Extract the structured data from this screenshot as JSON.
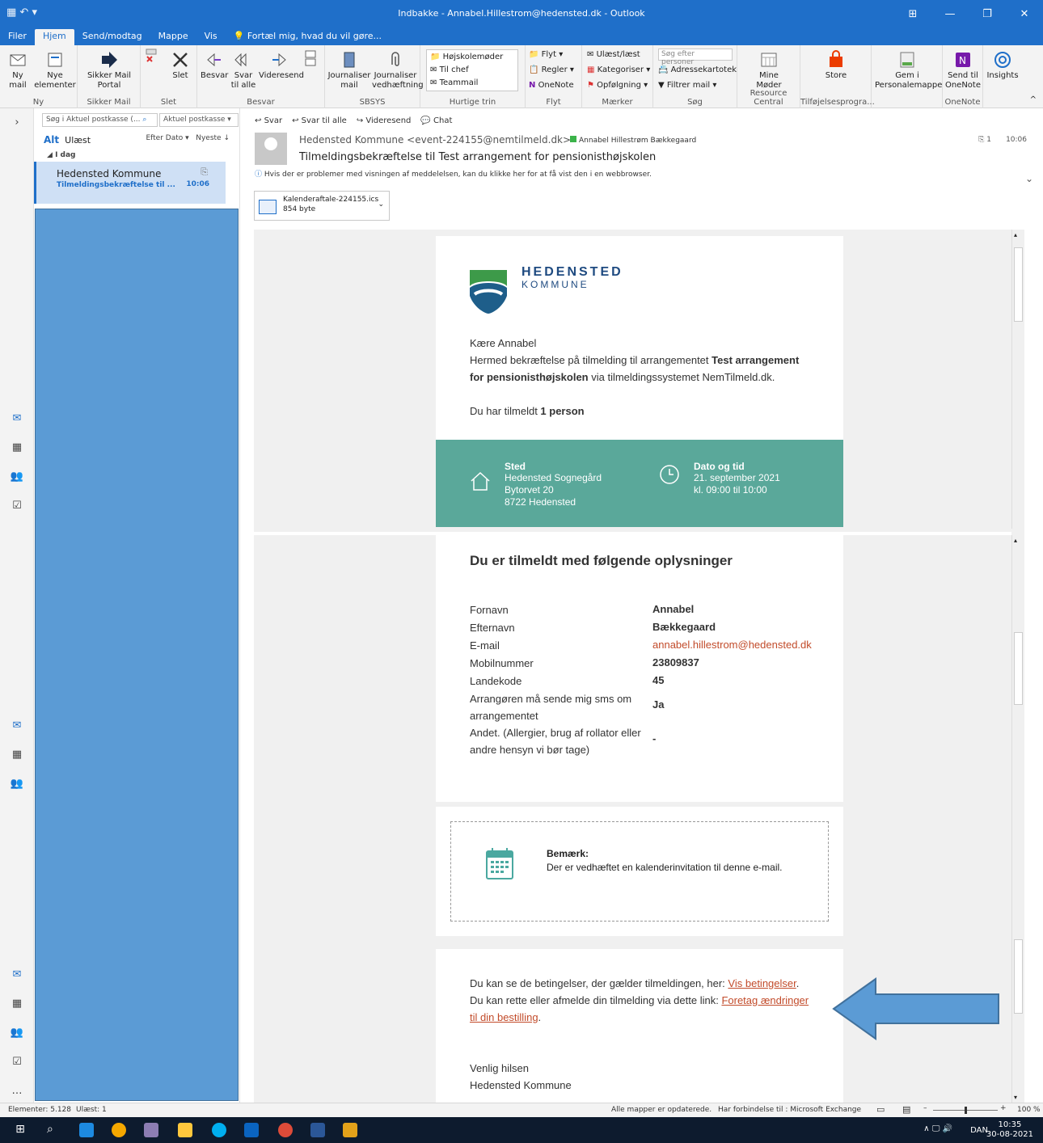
{
  "window": {
    "title": "Indbakke - Annabel.Hillestrom@hedensted.dk - Outlook",
    "restore_icon": "restore-icon",
    "min_icon": "minimize-icon",
    "max_icon": "maximize-icon",
    "close_icon": "close-icon"
  },
  "tabs": [
    "Filer",
    "Hjem",
    "Send/modtag",
    "Mappe",
    "Vis"
  ],
  "tell_me": "Fortæl mig, hvad du vil gøre...",
  "ribbon": {
    "ny_mail": "Ny\nmail",
    "nye_elementer": "Nye\nelementer",
    "group_ny": "Ny",
    "sikker_mail_portal": "Sikker Mail\nPortal",
    "group_sikker": "Sikker Mail",
    "slet": "Slet",
    "group_slet": "Slet",
    "besvar": "Besvar",
    "svar_til_alle": "Svar\ntil alle",
    "videresend": "Videresend",
    "group_besvar": "Besvar",
    "journaliser_mail": "Journaliser\nmail",
    "journaliser_vedh": "Journaliser\nvedhæftning",
    "group_sbsys": "SBSYS",
    "quick_steps": [
      "Højskolemøder",
      "Til chef",
      "Teammail"
    ],
    "group_quick": "Hurtige trin",
    "flyt": "Flyt",
    "regler": "Regler",
    "onenote": "OneNote",
    "group_flyt": "Flyt",
    "ulaest_laest": "Ulæst/læst",
    "kategoriser": "Kategoriser",
    "opfolgning": "Opfølgning",
    "group_maerker": "Mærker",
    "search_people": "Søg efter personer",
    "adressekartotek": "Adressekartotek",
    "filtrer_mail": "Filtrer mail",
    "group_sog": "Søg",
    "mine_moder": "Mine\nMøder",
    "group_resource": "Resource Central",
    "store": "Store",
    "group_tilf": "Tilføjelsesprogra...",
    "gem_i": "Gem i\nPersonalemappe",
    "send_til_onenote": "Send til\nOneNote",
    "group_onenote": "OneNote",
    "insights": "Insights"
  },
  "folder": {
    "search_placeholder": "Søg i Aktuel postkasse (...",
    "scope": "Aktuel postkasse",
    "filter_all": "Alt",
    "filter_unread": "Ulæst",
    "sort_by": "Efter Dato",
    "sort_order": "Nyeste",
    "group_today": "I dag",
    "message": {
      "sender": "Hedensted Kommune",
      "subject": "Tilmeldingsbekræftelse til ...",
      "time": "10:06"
    }
  },
  "reading": {
    "actions": [
      "Svar",
      "Svar til alle",
      "Videresend",
      "Chat"
    ],
    "sender": "Hedensted Kommune <event-224155@nemtilmeld.dk>",
    "recipient": "Annabel Hillestrøm Bækkegaard",
    "attach_count": "1",
    "time": "10:06",
    "subject": "Tilmeldingsbekræftelse til Test arrangement for pensionisthøjskolen",
    "info_bar": "Hvis der er problemer med visningen af meddelelsen, kan du klikke her for at få vist den i en webbrowser.",
    "attachment": {
      "name": "Kalenderaftale-224155.ics",
      "size": "854 byte"
    }
  },
  "email": {
    "logo_line1": "HEDENSTED",
    "logo_line2": "KOMMUNE",
    "greeting": "Kære Annabel",
    "intro_1": "Hermed bekræftelse på tilmelding til arrangementet ",
    "intro_bold": "Test arrangement for pensionisthøjskolen",
    "intro_2": " via tilmeldingssystemet NemTilmeld.dk.",
    "persons_pre": "Du har tilmeldt ",
    "persons_bold": "1 person",
    "place_label": "Sted",
    "place_lines": [
      "Hedensted Sognegård",
      "Bytorvet 20",
      "8722 Hedensted"
    ],
    "date_label": "Dato og tid",
    "date_lines": [
      "21. september 2021",
      "kl. 09:00 til 10:00"
    ],
    "info_title": "Du er tilmeldt med følgende oplysninger",
    "fields": [
      {
        "label": "Fornavn",
        "value": "Annabel"
      },
      {
        "label": "Efternavn",
        "value": "Bækkegaard"
      },
      {
        "label": "E-mail",
        "value": "annabel.hillestrom@hedensted.dk"
      },
      {
        "label": "Mobilnummer",
        "value": "23809837"
      },
      {
        "label": "Landekode",
        "value": "45"
      },
      {
        "label": "Arrangøren må sende mig sms om arrangementet",
        "value": "Ja"
      },
      {
        "label": "Andet. (Allergier, brug af rollator eller andre hensyn vi bør tage)",
        "value": "-"
      }
    ],
    "note_title": "Bemærk:",
    "note_text": "Der er vedhæftet en kalenderinvitation til denne e-mail.",
    "terms_pre": "Du kan se de betingelser, der gælder tilmeldingen, her: ",
    "terms_link": "Vis betingelser",
    "change_pre": "Du kan rette eller afmelde din tilmelding via dette link: ",
    "change_link": "Foretag ændringer til din bestilling",
    "regards": "Venlig hilsen",
    "regards_org": "Hedensted Kommune"
  },
  "status": {
    "elements": "Elementer: 5.128",
    "unread": "Ulæst: 1",
    "updated": "Alle mapper er opdaterede.",
    "connection": "Har forbindelse til : Microsoft Exchange",
    "zoom": "100 %",
    "zoom_fraction": 0.5
  },
  "taskbar": {
    "lang": "DAN",
    "time": "10:35",
    "date": "30-08-2021"
  },
  "colors": {
    "accent": "#1f6fc9",
    "teal": "#5aa89a",
    "link": "#c24b2a",
    "redact": "#5b9bd5"
  }
}
